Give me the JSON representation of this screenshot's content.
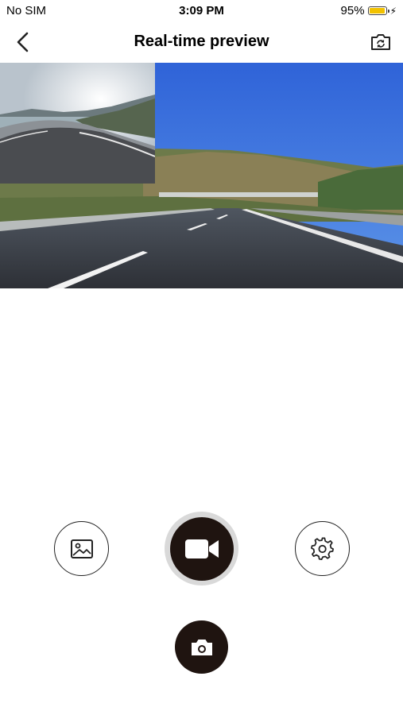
{
  "status_bar": {
    "carrier": "No SIM",
    "time": "3:09 PM",
    "battery_percent": "95%",
    "battery_level": 0.95,
    "battery_color": "#f2c200"
  },
  "nav": {
    "title": "Real-time preview",
    "back_icon": "chevron-left-icon",
    "switch_icon": "camera-switch-icon"
  },
  "preview": {
    "main_feed": "front-camera-road",
    "pip_feed": "rear-camera-road"
  },
  "controls": {
    "gallery_icon": "image-icon",
    "record_icon": "video-camera-icon",
    "settings_icon": "gear-icon",
    "photo_icon": "camera-icon",
    "dark_color": "#1f1410",
    "ring_color": "#d9d9d9"
  }
}
